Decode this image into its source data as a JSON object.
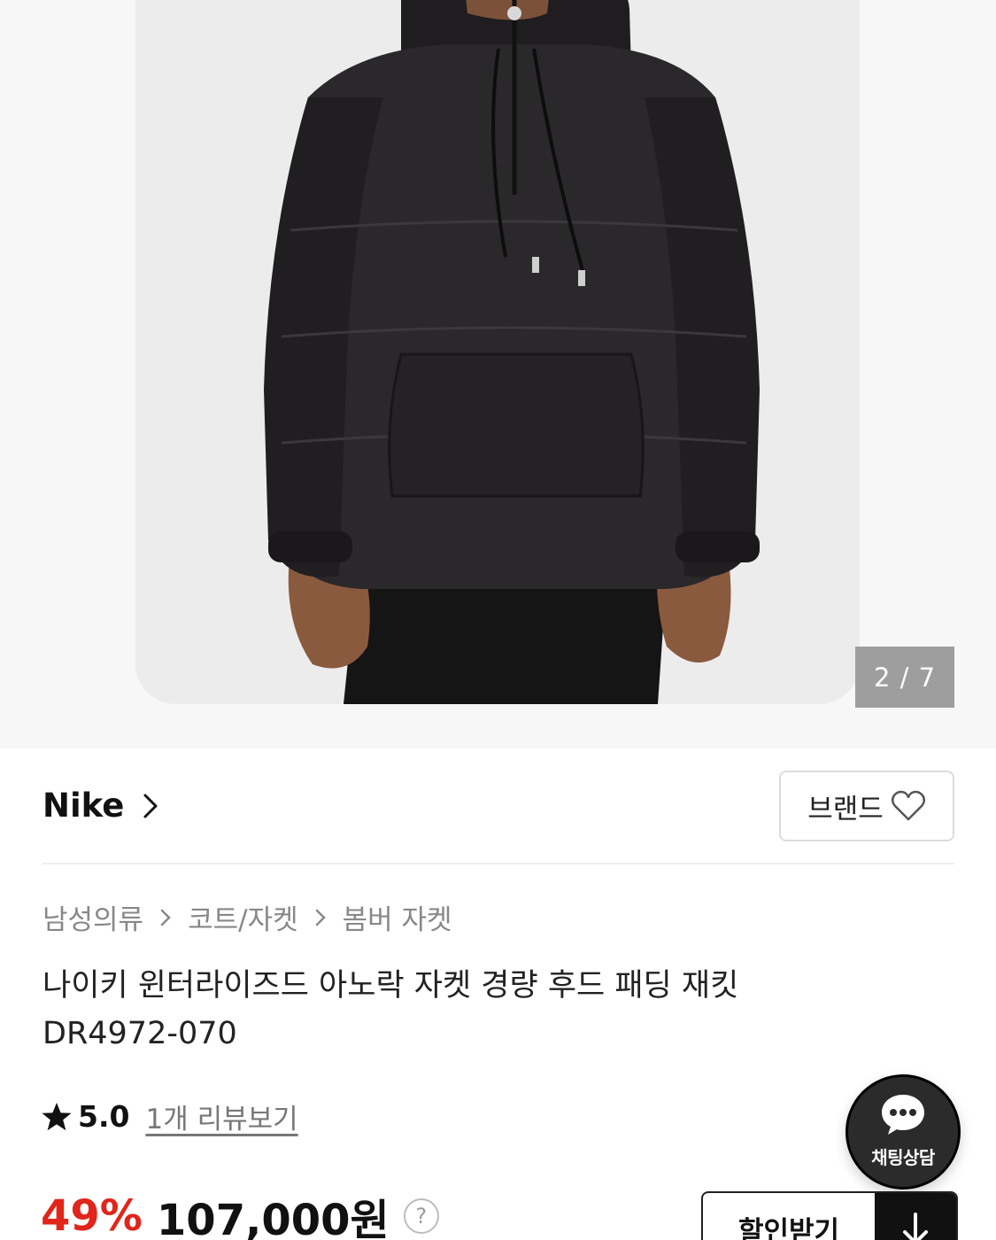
{
  "gallery": {
    "current_page": "2 / 7",
    "image_alt": "Black hooded anorak padded jacket"
  },
  "brand": {
    "name": "Nike",
    "follow_label": "브랜드"
  },
  "breadcrumb": [
    "남성의류",
    "코트/자켓",
    "봄버 자켓"
  ],
  "product": {
    "title_line1": "나이키 윈터라이즈드 아노락 자켓 경량 후드 패딩 재킷",
    "title_line2": "DR4972-070"
  },
  "rating": {
    "score": "5.0",
    "reviews_link": "1개 리뷰보기"
  },
  "price": {
    "discount": "49%",
    "amount": "107,000원",
    "help_symbol": "?"
  },
  "coupon": {
    "label": "할인받기"
  },
  "chat": {
    "label": "채팅상담"
  },
  "colors": {
    "discount_red": "#e1251b",
    "chat_bg": "#2b2b2b",
    "indicator_bg": "#9e9e9e"
  }
}
